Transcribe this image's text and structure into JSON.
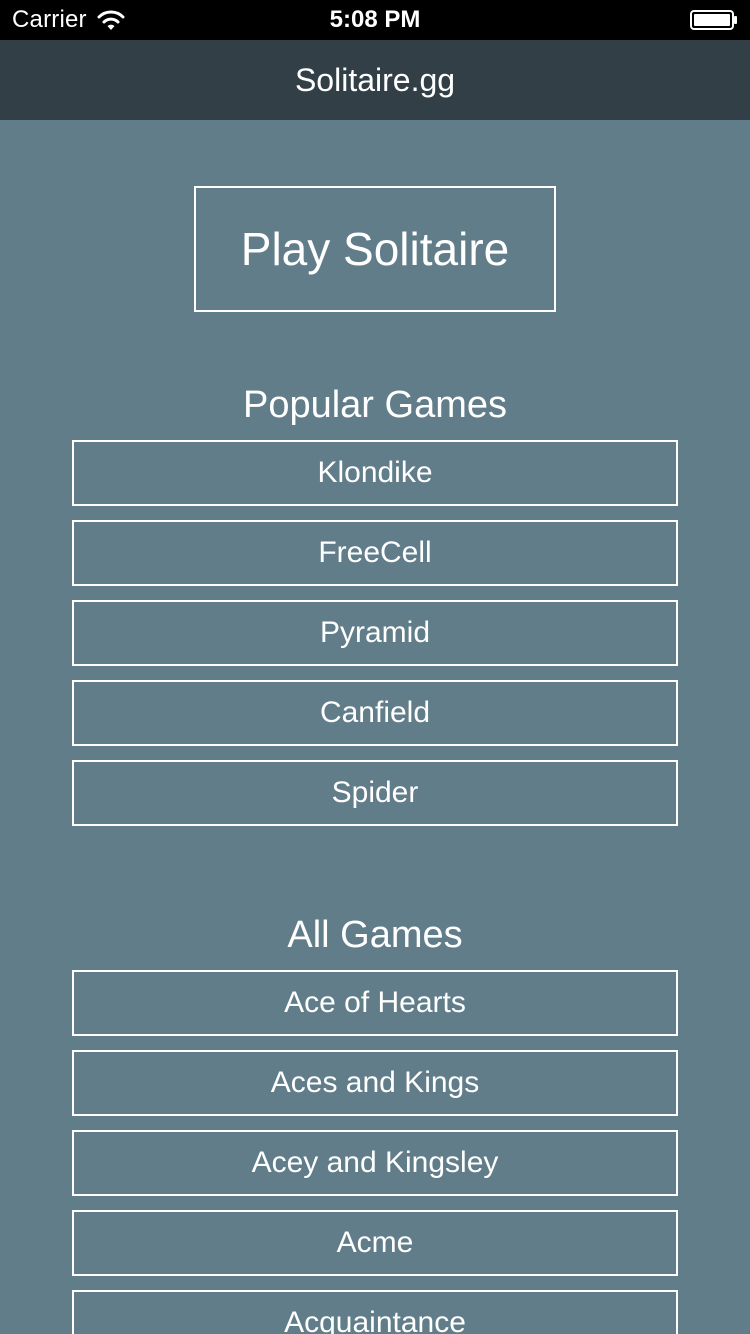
{
  "status_bar": {
    "carrier": "Carrier",
    "time": "5:08 PM",
    "wifi_icon": "wifi-icon",
    "battery_icon": "battery-icon"
  },
  "nav": {
    "title": "Solitaire.gg"
  },
  "main": {
    "play_label": "Play Solitaire",
    "popular_heading": "Popular Games",
    "popular_games": [
      "Klondike",
      "FreeCell",
      "Pyramid",
      "Canfield",
      "Spider"
    ],
    "all_heading": "All Games",
    "all_games": [
      "Ace of Hearts",
      "Aces and Kings",
      "Acey and Kingsley",
      "Acme",
      "Acquaintance"
    ]
  },
  "colors": {
    "background": "#617d89",
    "nav_bar": "#323f47",
    "status_bar": "#000000",
    "text": "#ffffff"
  }
}
